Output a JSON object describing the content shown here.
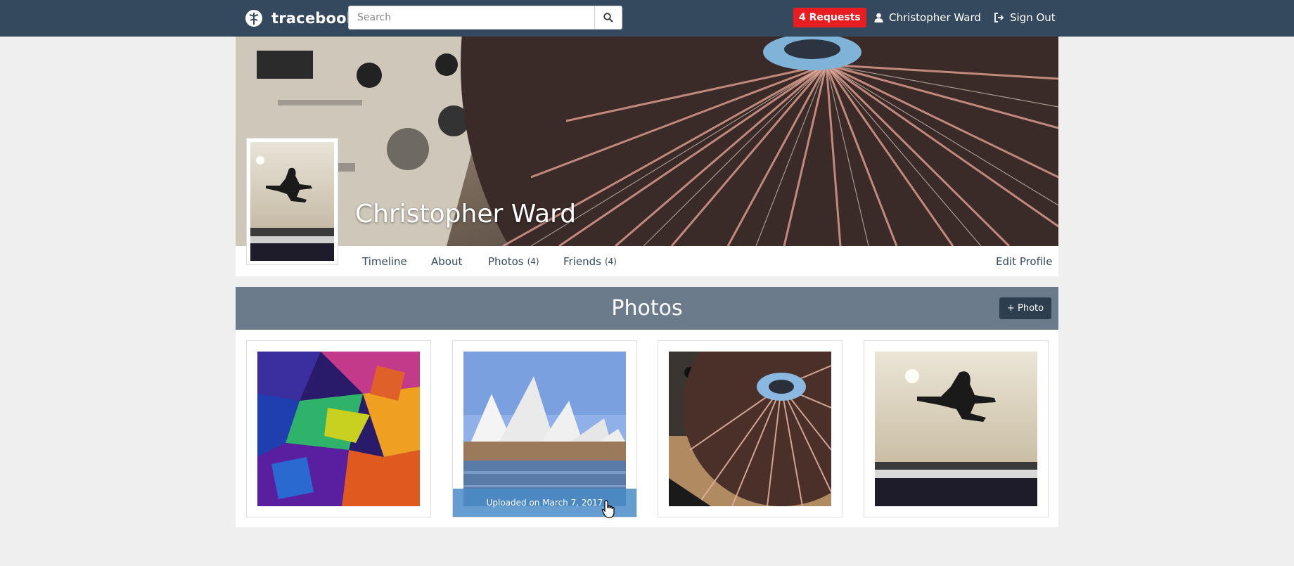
{
  "navbar": {
    "brand": "tracebook",
    "search_placeholder": "Search",
    "requests": "4 Requests",
    "user_name": "Christopher Ward",
    "sign_out": "Sign Out"
  },
  "profile": {
    "name": "Christopher Ward",
    "nav": {
      "timeline": "Timeline",
      "about": "About",
      "photos": "Photos",
      "photos_count": "(4)",
      "friends": "Friends",
      "friends_count": "(4)",
      "edit_profile": "Edit Profile"
    }
  },
  "photos_section": {
    "title": "Photos",
    "add_button": "+ Photo",
    "items": [
      {
        "subject": "abstract-colorful"
      },
      {
        "subject": "sydney-opera-house",
        "caption": "Uploaded on March 7, 2017"
      },
      {
        "subject": "turntable"
      },
      {
        "subject": "jumping-man"
      }
    ]
  },
  "colors": {
    "navbar": "#34495e",
    "requests_badge": "#e81d21",
    "photos_header": "#6b7b8c",
    "add_photo_button": "#2c3e50",
    "caption_overlay": "#4a8cc8",
    "link": "#34495e"
  }
}
